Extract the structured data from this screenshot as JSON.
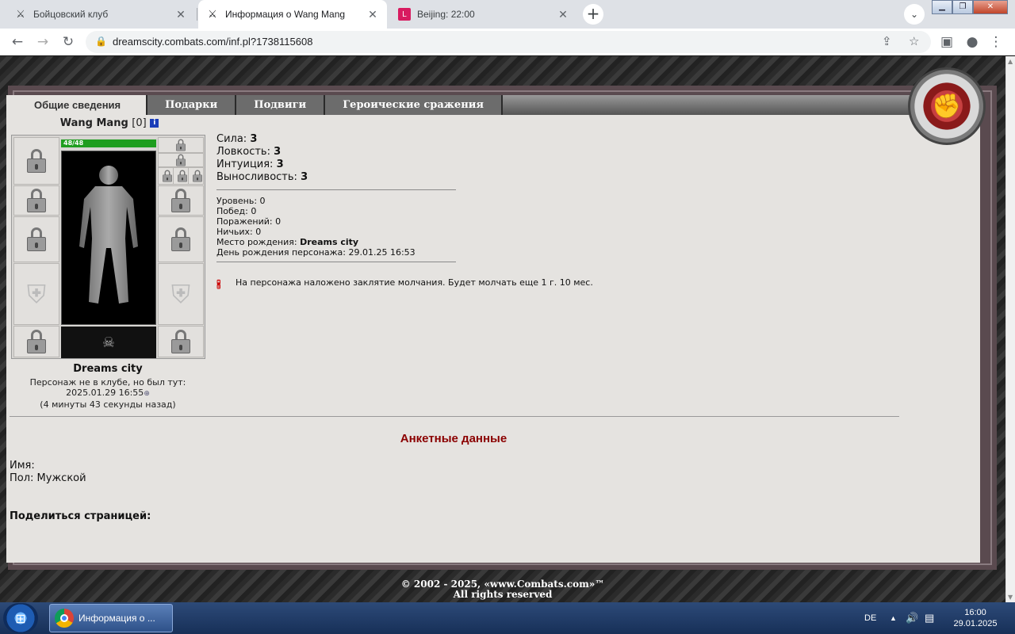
{
  "browser": {
    "tabs": [
      {
        "title": "Бойцовский клуб",
        "active": false
      },
      {
        "title": "Информация о Wang Mang",
        "active": true
      },
      {
        "title": "Beijing: 22:00",
        "active": false
      }
    ],
    "url": "dreamscity.combats.com/inf.pl?1738115608"
  },
  "page": {
    "tabs": [
      "Общие сведения",
      "Подарки",
      "Подвиги",
      "Героические сражения"
    ],
    "character": {
      "name": "Wang Mang",
      "level": "[0]",
      "hp": "48/48",
      "hp_fraction": 1.0,
      "city": "Dreams city",
      "status_line": "Персонаж не в клубе, но был тут:",
      "last_seen": "2025.01.29 16:55",
      "ago": "(4 минуты 43 секунды назад)"
    },
    "stats": [
      {
        "label": "Сила:",
        "value": "3"
      },
      {
        "label": "Ловкость:",
        "value": "3"
      },
      {
        "label": "Интуиция:",
        "value": "3"
      },
      {
        "label": "Выносливость:",
        "value": "3"
      }
    ],
    "details": {
      "level": "Уровень: 0",
      "wins": "Побед: 0",
      "losses": "Поражений: 0",
      "draws": "Ничьих: 0",
      "birthplace_label": "Место рождения:",
      "birthplace": "Dreams city",
      "birthday": "День рождения персонажа: 29.01.25 16:53"
    },
    "silence": "На персонажа наложено заклятие молчания. Будет молчать еще 1 г. 10 мес.",
    "anketa_title": "Анкетные данные",
    "profile": {
      "name_label": "Имя:",
      "gender": "Пол: Мужской"
    },
    "share_label": "Поделиться страницей:",
    "footer_line1": "© 2002 - 2025, «www.Combats.com»™",
    "footer_line2": "All rights reserved"
  },
  "taskbar": {
    "item": "Информация о ...",
    "lang": "DE",
    "time": "16:00",
    "date": "29.01.2025"
  }
}
